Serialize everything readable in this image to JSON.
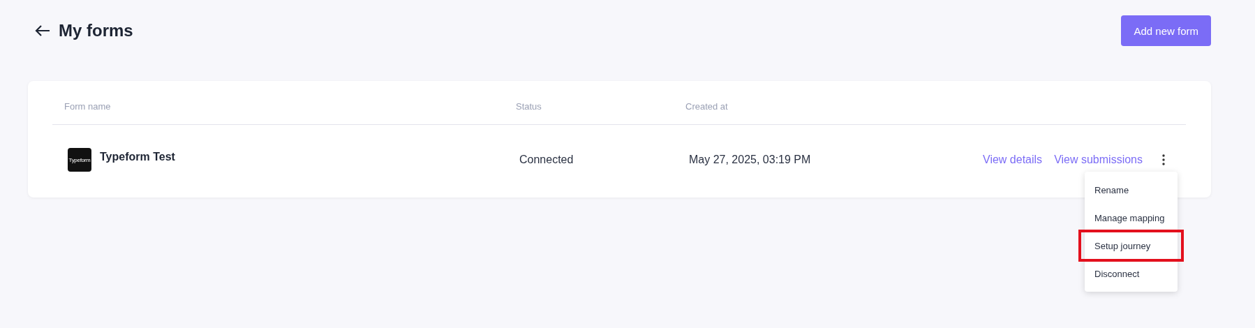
{
  "header": {
    "title": "My forms",
    "add_button": "Add new form"
  },
  "table": {
    "columns": [
      "Form name",
      "Status",
      "Created at"
    ],
    "rows": [
      {
        "logo_text": "Typeform",
        "name": "Typeform Test",
        "status": "Connected",
        "created_at": "May 27, 2025, 03:19 PM",
        "actions": [
          "View details",
          "View submissions"
        ],
        "menu_open": true
      }
    ]
  },
  "menu": {
    "items": [
      {
        "label": "Rename",
        "highlighted": false
      },
      {
        "label": "Manage mapping",
        "highlighted": false
      },
      {
        "label": "Setup journey",
        "highlighted": true
      },
      {
        "label": "Disconnect",
        "highlighted": false
      }
    ]
  }
}
